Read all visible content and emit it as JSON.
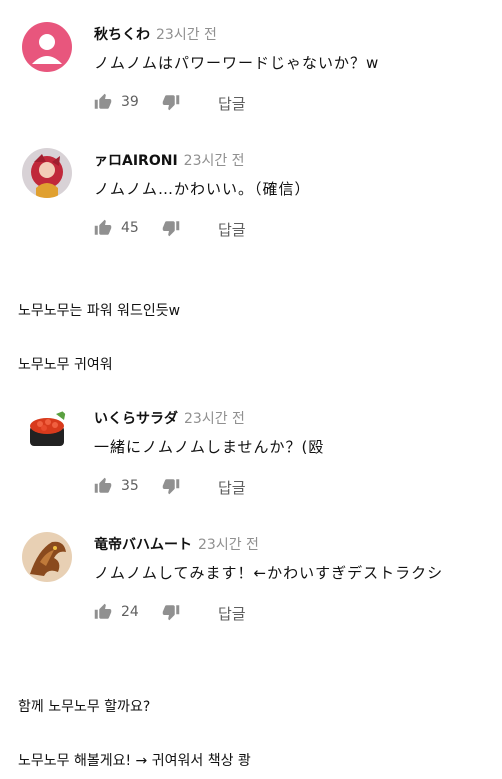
{
  "comments": [
    {
      "author": "秋ちくわ",
      "time": "23시간 전",
      "text": "ノムノムはパワーワードじゃないか？w",
      "likes": "39",
      "reply": "답글",
      "avatar": "pink-person-avatar"
    },
    {
      "author": "ァロAIRONI",
      "time": "23시간 전",
      "text": "ノムノム…かわいい。（確信）",
      "likes": "45",
      "reply": "답글",
      "avatar": "anime-character-avatar"
    },
    {
      "author": "いくらサラダ",
      "time": "23시간 전",
      "text": "一緒にノムノムしませんか？(殴",
      "likes": "35",
      "reply": "답글",
      "avatar": "ikura-sushi-avatar"
    },
    {
      "author": "竜帝バハムート",
      "time": "23시간 전",
      "text": "ノムノムしてみます！←かわいすぎデストラクシ",
      "likes": "24",
      "reply": "답글",
      "avatar": "dragon-avatar"
    }
  ],
  "notes": [
    "노무노무는 파워 워드인듯w",
    "노무노무 귀여워",
    "함께 노무노무 할까요?",
    "노무노무 해볼게요! → 귀여워서 책상 쾅"
  ]
}
